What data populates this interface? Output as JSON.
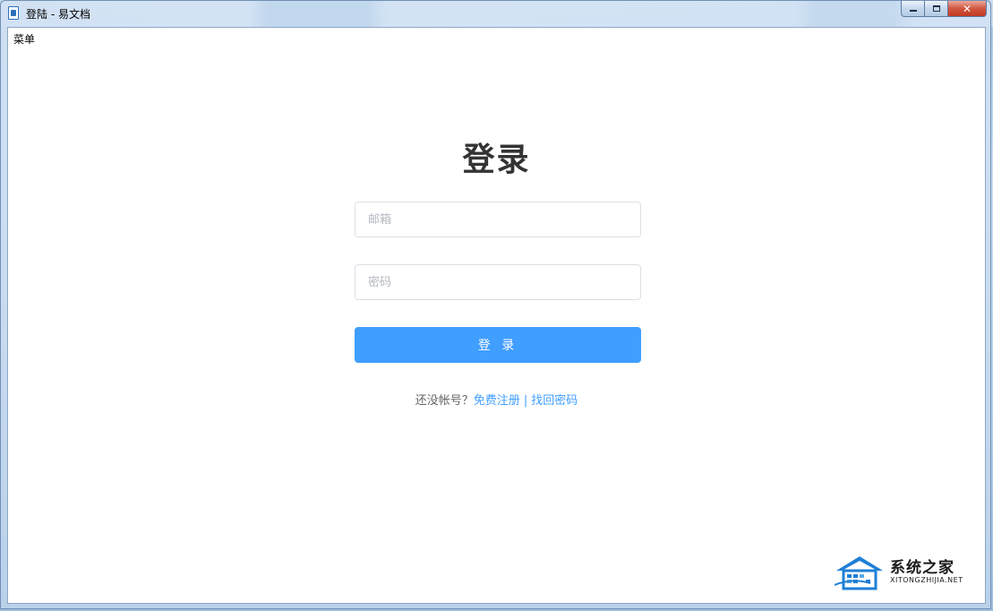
{
  "window": {
    "title": "登陆 - 易文档",
    "controls": {
      "minimize": "minimize-icon",
      "maximize": "maximize-icon",
      "close": "✕"
    }
  },
  "menubar": {
    "menu_label": "菜单"
  },
  "login": {
    "heading": "登录",
    "email_placeholder": "邮箱",
    "password_placeholder": "密码",
    "submit_label": "登 录",
    "prompt_text": "还没帐号？",
    "register_link": "免费注册",
    "separator": "|",
    "recover_link": "找回密码"
  },
  "watermark": {
    "title": "系统之家",
    "subtitle": "XITONGZHIJIA.NET"
  },
  "colors": {
    "primary": "#409eff",
    "heading": "#333333",
    "border": "#dcdfe6"
  }
}
